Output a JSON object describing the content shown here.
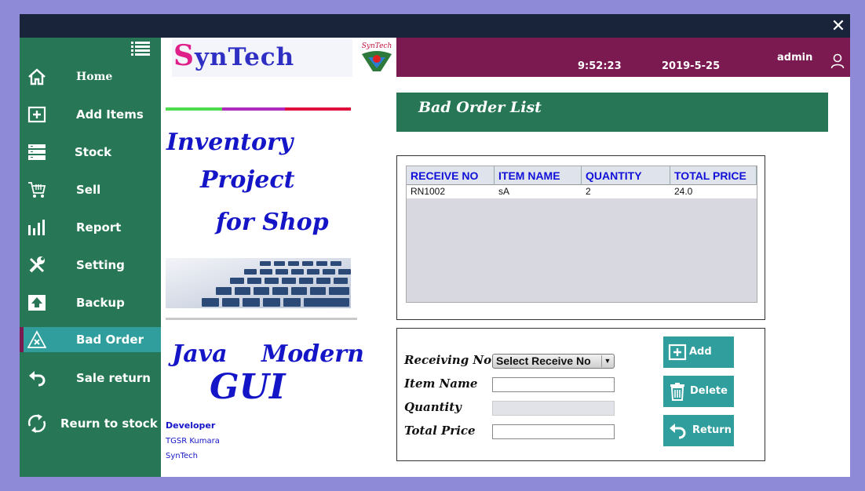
{
  "window": {
    "close_label": "✕"
  },
  "sidebar": {
    "items": [
      {
        "label": "Home",
        "icon": "home-icon"
      },
      {
        "label": "Add Items",
        "icon": "add-box-icon"
      },
      {
        "label": "Stock",
        "icon": "stack-icon"
      },
      {
        "label": "Sell",
        "icon": "cart-icon"
      },
      {
        "label": "Report",
        "icon": "bar-chart-icon"
      },
      {
        "label": "Setting",
        "icon": "tools-icon"
      },
      {
        "label": "Backup",
        "icon": "upload-icon"
      },
      {
        "label": "Bad Order",
        "icon": "warning-icon",
        "active": true
      },
      {
        "label": "Sale return",
        "icon": "undo-icon"
      },
      {
        "label": "Reurn to stock",
        "icon": "cycle-arrows-icon"
      }
    ]
  },
  "brand": {
    "logo_text_first": "S",
    "logo_text_rest": "ynTech",
    "badge_text": "SynTech",
    "title_lines": [
      "Inventory",
      "Project",
      "for Shop"
    ],
    "subtitle_line1_a": "Java",
    "subtitle_line1_b": "Modern",
    "subtitle_line2": "GUI",
    "developer_heading": "Developer",
    "developer_name": "TGSR Kumara",
    "developer_company": "SynTech",
    "stripe_colors": [
      "#4cdc4c",
      "#b02ac0",
      "#e0103c"
    ]
  },
  "topbar": {
    "time": "9:52:23",
    "date": "2019-5-25",
    "user": "admin"
  },
  "page": {
    "title": "Bad Order List"
  },
  "table": {
    "columns": [
      "RECEIVE NO",
      "ITEM NAME",
      "QUANTITY",
      "TOTAL PRICE"
    ],
    "rows": [
      [
        "RN1002",
        "sA",
        "2",
        "24.0"
      ]
    ]
  },
  "form": {
    "receiving_label": "Receiving No",
    "receiving_value": "Select Receive No",
    "item_label": "Item Name",
    "item_value": "",
    "quantity_label": "Quantity",
    "quantity_value": "",
    "total_label": "Total Price",
    "total_value": ""
  },
  "actions": {
    "add": "Add",
    "delete": "Delete",
    "return": "Return"
  },
  "colors": {
    "sidebar": "#277756",
    "topbar": "#7a1a50",
    "accent": "#2f9e9d",
    "titlebar": "#19233a"
  }
}
